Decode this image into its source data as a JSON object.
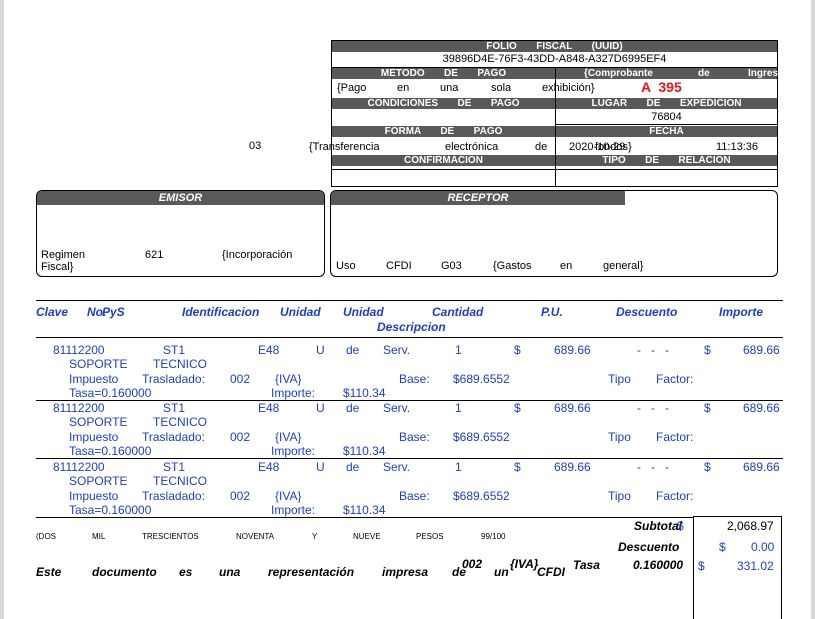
{
  "folio": {
    "title": "FOLIO       FISCAL       (UUID)",
    "uuid": "39896D4E-76F3-43DD-A848-A327D6995EF4",
    "serie_folio": "A  395"
  },
  "metodo_pago": {
    "label": "METODO       DE       PAGO",
    "value_words": [
      "{Pago",
      "en",
      "una",
      "sola",
      "exhibición}"
    ]
  },
  "comprobante": {
    "label_words": [
      "{Comprobante",
      "de",
      "Ingres"
    ]
  },
  "condiciones": {
    "label": "CONDICIONES       DE       PAGO"
  },
  "lugar": {
    "label": "LUGAR       DE       EXPEDICION",
    "value": "76804"
  },
  "forma_pago": {
    "label": "FORMA       DE       PAGO",
    "code": "03",
    "value_words": [
      "{Transferencia",
      "electrónica",
      "de"
    ]
  },
  "fecha": {
    "label": "FECHA",
    "date": "2020-10-29",
    "overlap": "fondos}",
    "time": "11:13:36"
  },
  "confirmacion": {
    "label": "CONFIRMACION"
  },
  "tipo_relacion": {
    "label": "TIPO       DE       RELACION"
  },
  "emisor": {
    "title": "EMISOR",
    "regimen_label": "Regimen",
    "regimen_label2": "Fiscal}",
    "regimen_code": "621",
    "regimen_desc": "{Incorporación"
  },
  "receptor": {
    "title": "RECEPTOR",
    "uso_words": [
      "Uso",
      "CFDI",
      "G03",
      "{Gastos",
      "en",
      "general}"
    ]
  },
  "table": {
    "headers": {
      "clave": "Clave",
      "no": "No.",
      "pys": "PyS",
      "identificacion": "Identificacion",
      "unidad1": "Unidad",
      "unidad2": "Unidad",
      "descripcion": "Descripcion",
      "cantidad": "Cantidad",
      "pu": "P.U.",
      "descuento": "Descuento",
      "importe": "Importe"
    },
    "rows": [
      {
        "clave": "81112200",
        "ident": "ST1",
        "unidad": "E48",
        "u": "U",
        "de": "de",
        "serv": "Serv.",
        "cantidad": "1",
        "pu_sign": "$",
        "pu": "689.66",
        "desc": "-   -   -",
        "imp_sign": "$",
        "importe": "689.66",
        "desc1": "SOPORTE",
        "desc2": "TECNICO",
        "impuesto": "Impuesto",
        "trasladado": "Trasladado:",
        "code": "002",
        "iva": "{IVA}",
        "base_label": "Base:",
        "base": "$689.6552",
        "tipo": "Tipo",
        "factor": "Factor:",
        "tasa": "Tasa=0.160000",
        "importe_label": "Importe:",
        "importe_imp": "$110.34"
      },
      {
        "clave": "81112200",
        "ident": "ST1",
        "unidad": "E48",
        "u": "U",
        "de": "de",
        "serv": "Serv.",
        "cantidad": "1",
        "pu_sign": "$",
        "pu": "689.66",
        "desc": "-   -   -",
        "imp_sign": "$",
        "importe": "689.66",
        "desc1": "SOPORTE",
        "desc2": "TECNICO",
        "impuesto": "Impuesto",
        "trasladado": "Trasladado:",
        "code": "002",
        "iva": "{IVA}",
        "base_label": "Base:",
        "base": "$689.6552",
        "tipo": "Tipo",
        "factor": "Factor:",
        "tasa": "Tasa=0.160000",
        "importe_label": "Importe:",
        "importe_imp": "$110.34"
      },
      {
        "clave": "81112200",
        "ident": "ST1",
        "unidad": "E48",
        "u": "U",
        "de": "de",
        "serv": "Serv.",
        "cantidad": "1",
        "pu_sign": "$",
        "pu": "689.66",
        "desc": "-   -   -",
        "imp_sign": "$",
        "importe": "689.66",
        "desc1": "SOPORTE",
        "desc2": "TECNICO",
        "impuesto": "Impuesto",
        "trasladado": "Trasladado:",
        "code": "002",
        "iva": "{IVA}",
        "base_label": "Base:",
        "base": "$689.6552",
        "tipo": "Tipo",
        "factor": "Factor:",
        "tasa": "Tasa=0.160000",
        "importe_label": "Importe:",
        "importe_imp": "$110.34"
      }
    ]
  },
  "importe_letra": [
    "(DOS",
    "MIL",
    "TRESCIENTOS",
    "NOVENTA",
    "Y",
    "NUEVE",
    "PESOS",
    "99/100"
  ],
  "leyenda": [
    "Este",
    "documento",
    "es",
    "una",
    "representación",
    "impresa",
    "de",
    "un",
    "CFDI"
  ],
  "leyenda_overlap": {
    "code": "002",
    "iva": "{IVA}",
    "tasa": "Tasa",
    "tasa_val": "0.160000"
  },
  "totales": {
    "subtotal_label": "Subtotal",
    "subtotal_sign": "$",
    "subtotal": "2,068.97",
    "descuento_label": "Descuento",
    "descuento_sign": "$",
    "descuento": "0.00",
    "iva_sign": "$",
    "iva": "331.02"
  },
  "colors": {
    "header_bar": "#595959",
    "item_text": "#1f3fbf",
    "folio_red": "#e8141b"
  }
}
